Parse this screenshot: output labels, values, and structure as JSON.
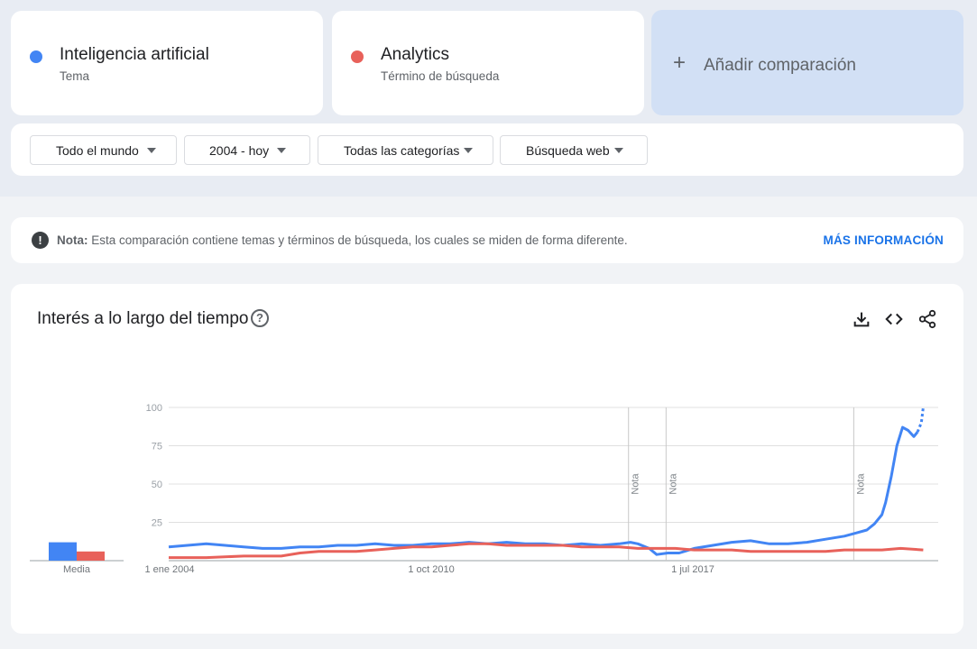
{
  "terms": [
    {
      "name": "Inteligencia artificial",
      "kind": "Tema",
      "color": "#4285f4"
    },
    {
      "name": "Analytics",
      "kind": "Término de búsqueda",
      "color": "#e8615a"
    }
  ],
  "add_comparison": {
    "icon": "plus-icon",
    "label": "Añadir comparación"
  },
  "filters": [
    {
      "label": "Todo el mundo"
    },
    {
      "label": "2004 - hoy"
    },
    {
      "label": "Todas las categorías"
    },
    {
      "label": "Búsqueda web"
    }
  ],
  "note": {
    "prefix": "Nota:",
    "text": "Esta comparación contiene temas y términos de búsqueda, los cuales se miden de forma diferente.",
    "link": "MÁS INFORMACIÓN"
  },
  "chart_section": {
    "title": "Interés a lo largo del tiempo",
    "tools": [
      "download-icon",
      "embed-icon",
      "share-icon"
    ]
  },
  "chart_data": {
    "type": "line",
    "title": "Interés a lo largo del tiempo",
    "x_tick_labels": [
      "1 ene 2004",
      "1 oct 2010",
      "1 jul 2017"
    ],
    "y_ticks": [
      25,
      50,
      75,
      100
    ],
    "ylim": [
      0,
      100
    ],
    "xlim": [
      2004.0,
      2024.5
    ],
    "grid": true,
    "annotations": [
      {
        "label": "Nota",
        "x": 2016.25
      },
      {
        "label": "Nota",
        "x": 2017.25
      },
      {
        "label": "Nota",
        "x": 2022.25
      }
    ],
    "averages": {
      "label": "Media",
      "values": [
        12,
        6
      ]
    },
    "series": [
      {
        "name": "Inteligencia artificial",
        "color": "#4285f4",
        "points": [
          [
            2004.0,
            9
          ],
          [
            2004.5,
            10
          ],
          [
            2005.0,
            11
          ],
          [
            2005.5,
            10
          ],
          [
            2006.0,
            9
          ],
          [
            2006.5,
            8
          ],
          [
            2007.0,
            8
          ],
          [
            2007.5,
            9
          ],
          [
            2008.0,
            9
          ],
          [
            2008.5,
            10
          ],
          [
            2009.0,
            10
          ],
          [
            2009.5,
            11
          ],
          [
            2010.0,
            10
          ],
          [
            2010.5,
            10
          ],
          [
            2011.0,
            11
          ],
          [
            2011.5,
            11
          ],
          [
            2012.0,
            12
          ],
          [
            2012.5,
            11
          ],
          [
            2013.0,
            12
          ],
          [
            2013.5,
            11
          ],
          [
            2014.0,
            11
          ],
          [
            2014.5,
            10
          ],
          [
            2015.0,
            11
          ],
          [
            2015.5,
            10
          ],
          [
            2016.0,
            11
          ],
          [
            2016.3,
            12
          ],
          [
            2016.5,
            11
          ],
          [
            2016.8,
            8
          ],
          [
            2017.0,
            4
          ],
          [
            2017.3,
            5
          ],
          [
            2017.6,
            5
          ],
          [
            2018.0,
            8
          ],
          [
            2018.5,
            10
          ],
          [
            2019.0,
            12
          ],
          [
            2019.5,
            13
          ],
          [
            2020.0,
            11
          ],
          [
            2020.5,
            11
          ],
          [
            2021.0,
            12
          ],
          [
            2021.5,
            14
          ],
          [
            2022.0,
            16
          ],
          [
            2022.3,
            18
          ],
          [
            2022.6,
            20
          ],
          [
            2022.8,
            24
          ],
          [
            2023.0,
            30
          ],
          [
            2023.1,
            38
          ],
          [
            2023.25,
            55
          ],
          [
            2023.4,
            75
          ],
          [
            2023.55,
            87
          ],
          [
            2023.7,
            85
          ],
          [
            2023.85,
            81
          ],
          [
            2023.95,
            84
          ]
        ],
        "partial_points": [
          [
            2023.95,
            84
          ],
          [
            2024.05,
            90
          ],
          [
            2024.1,
            100
          ]
        ]
      },
      {
        "name": "Analytics",
        "color": "#e8615a",
        "points": [
          [
            2004.0,
            2
          ],
          [
            2005.0,
            2
          ],
          [
            2006.0,
            3
          ],
          [
            2007.0,
            3
          ],
          [
            2007.5,
            5
          ],
          [
            2008.0,
            6
          ],
          [
            2009.0,
            6
          ],
          [
            2009.5,
            7
          ],
          [
            2010.0,
            8
          ],
          [
            2010.5,
            9
          ],
          [
            2011.0,
            9
          ],
          [
            2011.5,
            10
          ],
          [
            2012.0,
            11
          ],
          [
            2012.5,
            11
          ],
          [
            2013.0,
            10
          ],
          [
            2013.5,
            10
          ],
          [
            2014.0,
            10
          ],
          [
            2014.5,
            10
          ],
          [
            2015.0,
            9
          ],
          [
            2015.5,
            9
          ],
          [
            2016.0,
            9
          ],
          [
            2016.5,
            8
          ],
          [
            2017.0,
            8
          ],
          [
            2017.5,
            8
          ],
          [
            2018.0,
            7
          ],
          [
            2018.5,
            7
          ],
          [
            2019.0,
            7
          ],
          [
            2019.5,
            6
          ],
          [
            2020.0,
            6
          ],
          [
            2020.5,
            6
          ],
          [
            2021.0,
            6
          ],
          [
            2021.5,
            6
          ],
          [
            2022.0,
            7
          ],
          [
            2022.5,
            7
          ],
          [
            2023.0,
            7
          ],
          [
            2023.5,
            8
          ],
          [
            2024.1,
            7
          ]
        ]
      }
    ]
  }
}
